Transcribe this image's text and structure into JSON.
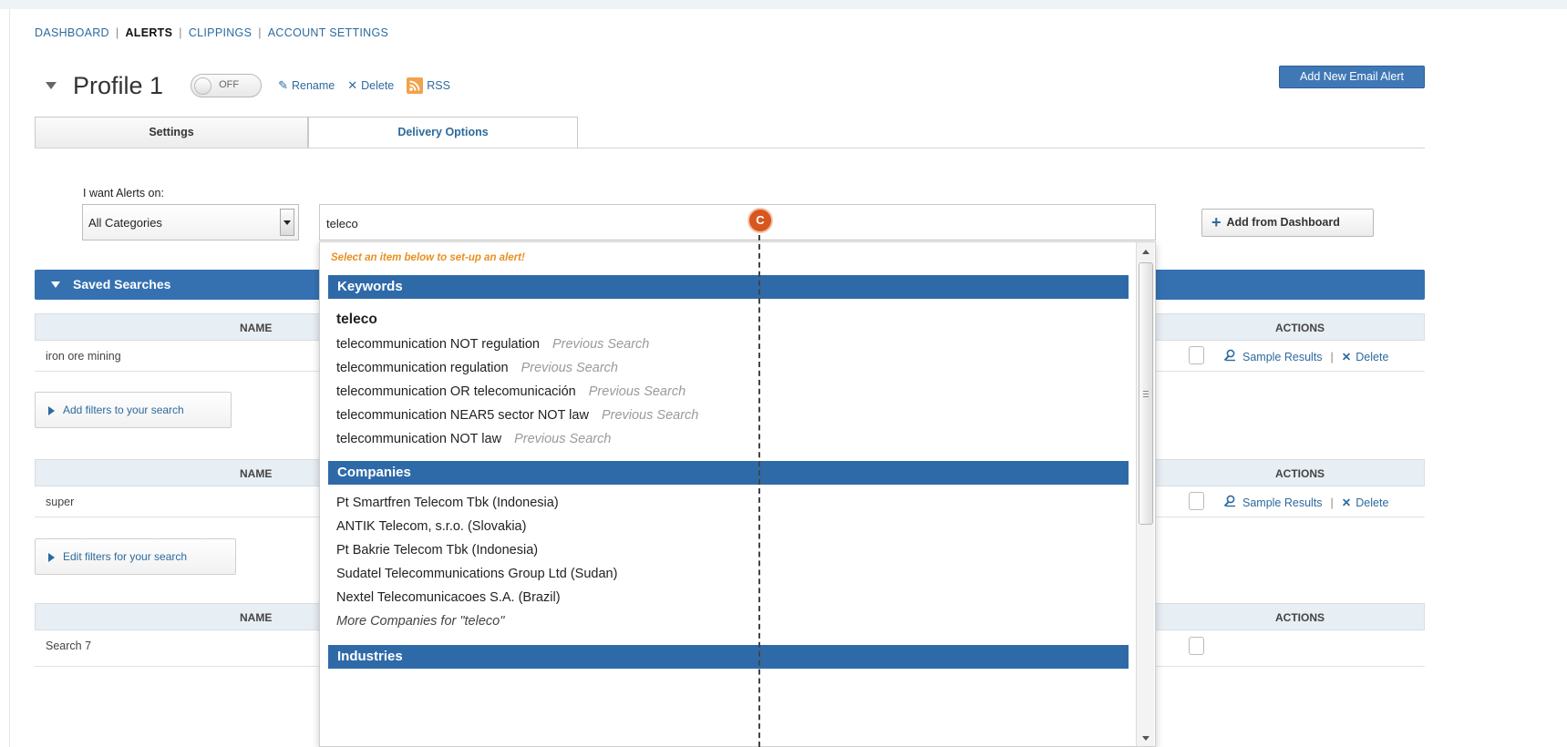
{
  "topnav": {
    "dashboard": "DASHBOARD",
    "alerts": "ALERTS",
    "clippings": "CLIPPINGS",
    "account_settings": "ACCOUNT SETTINGS",
    "separator": "|"
  },
  "profile": {
    "title": "Profile 1",
    "toggle_state": "OFF",
    "rename": "Rename",
    "delete": "Delete",
    "rss": "RSS"
  },
  "header_buttons": {
    "add_new_email_alert": "Add New Email Alert"
  },
  "tabs": [
    {
      "label": "Settings",
      "active": false
    },
    {
      "label": "Delivery Options",
      "active": true
    }
  ],
  "alerts_on": {
    "label": "I want Alerts on:",
    "category_value": "All Categories",
    "search_value": "teleco",
    "add_from_dashboard": "Add from Dashboard"
  },
  "cursor_marker": "C",
  "saved_searches": {
    "title": "Saved Searches",
    "groups": [
      {
        "name_header": "NAME",
        "actions_header": "ACTIONS",
        "row_name": "iron ore mining",
        "sample_results": "Sample Results",
        "delete": "Delete",
        "filter_button": "Add filters to your search"
      },
      {
        "name_header": "NAME",
        "actions_header": "ACTIONS",
        "row_name": "super",
        "sample_results": "Sample Results",
        "delete": "Delete",
        "filter_button": "Edit filters for your search"
      },
      {
        "name_header": "NAME",
        "actions_header": "ACTIONS",
        "row_name": "Search 7"
      }
    ]
  },
  "dropdown": {
    "hint": "Select an item below to set-up an alert!",
    "sections": {
      "keywords": "Keywords",
      "companies": "Companies",
      "industries": "Industries"
    },
    "keywords": [
      {
        "text": "teleco",
        "note": ""
      },
      {
        "text": "telecommunication NOT regulation",
        "note": "Previous Search"
      },
      {
        "text": "telecommunication regulation",
        "note": "Previous Search"
      },
      {
        "text": "telecommunication OR telecomunicación",
        "note": "Previous Search"
      },
      {
        "text": "telecommunication NEAR5 sector NOT law",
        "note": "Previous Search"
      },
      {
        "text": "telecommunication NOT law",
        "note": "Previous Search"
      }
    ],
    "companies": [
      "Pt Smartfren Telecom Tbk (Indonesia)",
      "ANTIK Telecom, s.r.o. (Slovakia)",
      "Pt Bakrie Telecom Tbk (Indonesia)",
      "Sudatel Telecommunications Group Ltd (Sudan)",
      "Nextel Telecomunicacoes S.A. (Brazil)"
    ],
    "more_companies": "More Companies for \"teleco\""
  },
  "colors": {
    "accent_blue": "#3571b1",
    "link_blue": "#2c6a9e",
    "hint_orange": "#e8901f",
    "cursor_marker": "#d7571f"
  }
}
